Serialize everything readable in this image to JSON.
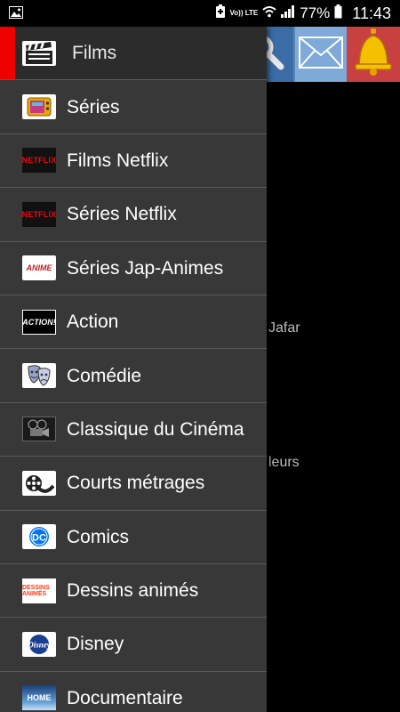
{
  "statusbar": {
    "battery_percent": "77%",
    "time": "11:43",
    "volte_label": "Vo)) LTE"
  },
  "background": {
    "text_1": "Jafar",
    "text_2": "leurs"
  },
  "drawer": {
    "items": [
      {
        "label": "Films",
        "icon": "clapperboard-icon",
        "active": true
      },
      {
        "label": "Séries",
        "icon": "tv-icon"
      },
      {
        "label": "Films Netflix",
        "icon": "netflix-logo-icon",
        "badge": "NETFLIX"
      },
      {
        "label": "Séries Netflix",
        "icon": "netflix-logo-icon",
        "badge": "NETFLIX"
      },
      {
        "label": "Séries Jap-Animes",
        "icon": "anime-logo-icon",
        "badge": "ANIME"
      },
      {
        "label": "Action",
        "icon": "action-logo-icon",
        "badge": "ACTION!"
      },
      {
        "label": "Comédie",
        "icon": "theatre-masks-icon"
      },
      {
        "label": "Classique du Cinéma",
        "icon": "film-projector-icon"
      },
      {
        "label": "Courts métrages",
        "icon": "film-reel-icon"
      },
      {
        "label": "Comics",
        "icon": "dc-logo-icon",
        "badge": "DC"
      },
      {
        "label": "Dessins animés",
        "icon": "cartoon-logo-icon",
        "badge": "DESSINS ANIMÉS"
      },
      {
        "label": "Disney",
        "icon": "disney-logo-icon",
        "badge": "Disney"
      },
      {
        "label": "Documentaire",
        "icon": "earth-home-icon",
        "badge": "HOME"
      }
    ]
  },
  "colors": {
    "drawer_bg": "#383838",
    "active_indicator": "#ee0000",
    "netflix_red": "#e50914"
  }
}
